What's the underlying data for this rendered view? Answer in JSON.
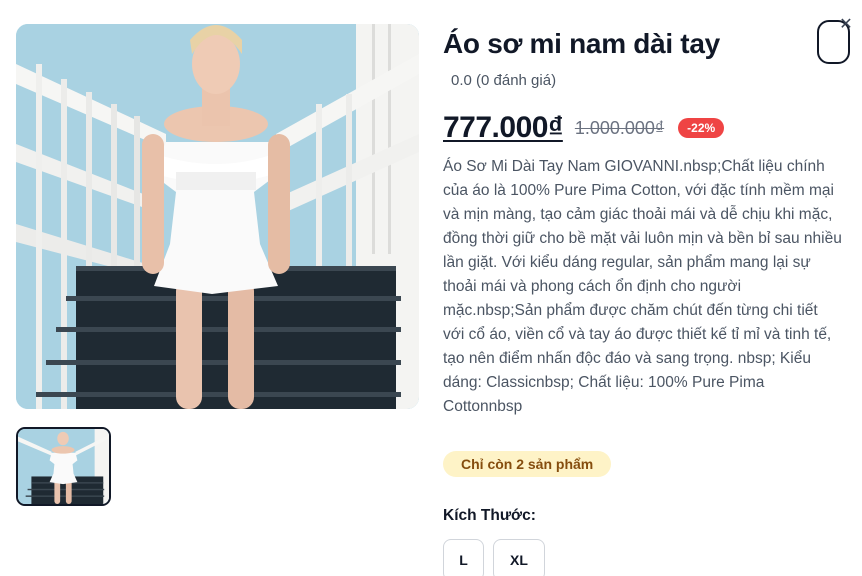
{
  "product": {
    "title": "Áo sơ mi nam dài tay",
    "rating_text": "0.0 (0 đánh giá)",
    "price": "777.000₫",
    "original_price": "1.000.000₫",
    "discount": "-22%",
    "description": "Áo Sơ Mi Dài Tay Nam GIOVANNI.nbsp;Chất liệu chính của áo là 100% Pure Pima Cotton, với đặc tính mềm mại và mịn màng, tạo cảm giác thoải mái và dễ chịu khi mặc, đồng thời giữ cho bề mặt vải luôn mịn và bền bỉ sau nhiều lần giặt. Với kiểu dáng regular, sản phẩm mang lại sự thoải mái và phong cách ổn định cho người mặc.nbsp;Sản phẩm được chăm chút đến từng chi tiết với cổ áo, viền cổ và tay áo được thiết kế tỉ mỉ và tinh tế, tạo nên điểm nhấn độc đáo và sang trọng. nbsp; Kiểu dáng: Classicnbsp; Chất liệu: 100% Pure Pima Cottonnbsp",
    "stock_badge": "Chỉ còn 2 sản phẩm",
    "size_label": "Kích Thước:",
    "sizes": [
      "L",
      "XL"
    ]
  },
  "icons": {
    "close": "close-icon",
    "oval_button": "wishlist-toggle"
  },
  "colors": {
    "discount_badge": "#ef4444",
    "stock_badge_bg": "#fef3c7",
    "stock_badge_text": "#854d0e"
  }
}
